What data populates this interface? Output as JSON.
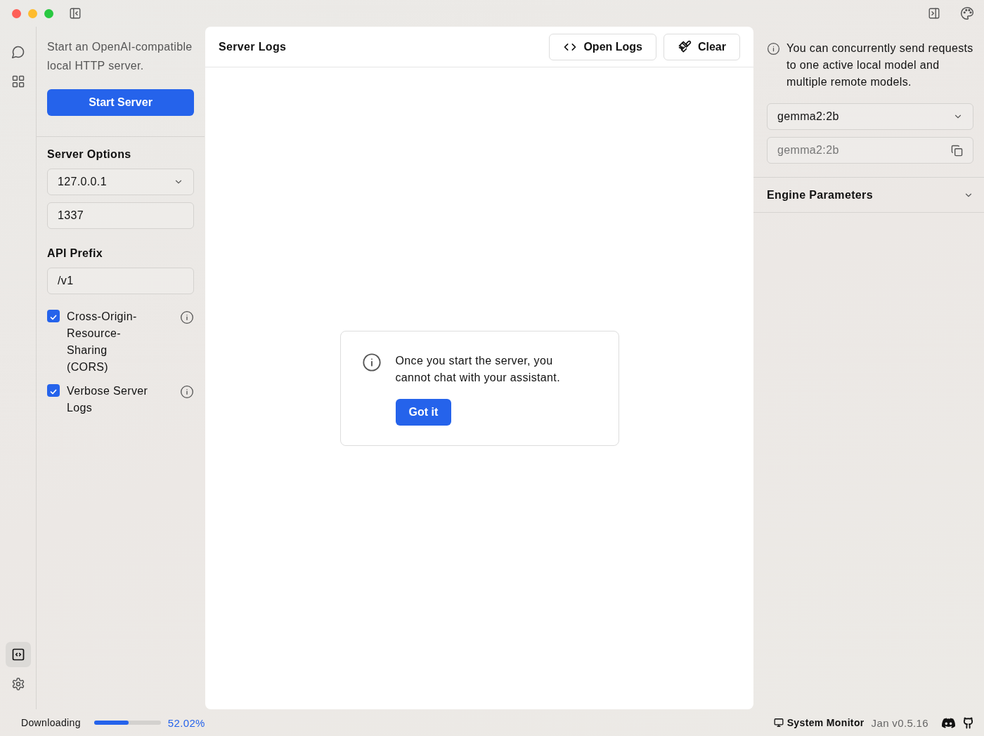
{
  "rail": [
    {
      "kind": "chat",
      "selected": false
    },
    {
      "kind": "grid",
      "selected": false
    }
  ],
  "rail_bottom": [
    {
      "kind": "code",
      "selected": true
    },
    {
      "kind": "settings",
      "selected": false
    }
  ],
  "left_panel": {
    "description": "Start an OpenAI-compatible local HTTP server.",
    "start_button": "Start Server",
    "server_options_heading": "Server Options",
    "host": "127.0.0.1",
    "port": "1337",
    "api_prefix_heading": "API Prefix",
    "api_prefix": "/v1",
    "options": [
      {
        "label": "Cross-Origin-Resource-Sharing (CORS)",
        "checked": true
      },
      {
        "label": "Verbose Server Logs",
        "checked": true
      }
    ]
  },
  "server_logs": {
    "title": "Server Logs",
    "buttons": [
      {
        "label": "Open Logs",
        "kind": "code"
      },
      {
        "label": "Clear",
        "kind": "brush"
      }
    ],
    "notice": {
      "text": "Once you start the server, you cannot chat with your assistant.",
      "button": "Got it"
    }
  },
  "right_panel": {
    "info": "You can concurrently send requests to one active local model and multiple remote models.",
    "model_select": "gemma2:2b",
    "model_id": "gemma2:2b",
    "engine_parameters": {
      "label": "Engine Parameters",
      "expanded": false
    }
  },
  "status_bar": {
    "download_label": "Downloading",
    "download": {
      "level": 0.52
    },
    "download_percent": "52.02%",
    "system_monitor": "System Monitor",
    "version": "Jan v0.5.16"
  }
}
